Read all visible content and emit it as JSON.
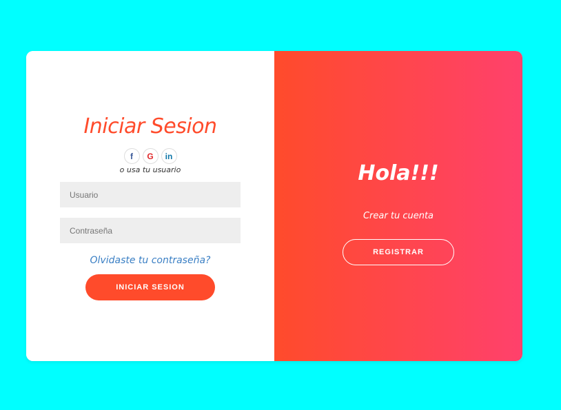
{
  "login": {
    "title": "Iniciar Sesion",
    "social": [
      {
        "name": "facebook-icon",
        "glyph": "f"
      },
      {
        "name": "google-icon",
        "glyph": "G"
      },
      {
        "name": "linkedin-icon",
        "glyph": "in"
      }
    ],
    "alt_text": "o usa tu usuario",
    "username_placeholder": "Usuario",
    "password_placeholder": "Contraseña",
    "forgot_link": "Olvidaste tu contraseña?",
    "submit_label": "INICIAR SESION"
  },
  "overlay": {
    "title": "Hola!!!",
    "subtitle": "Crear tu cuenta",
    "register_label": "REGISTRAR"
  },
  "colors": {
    "page_background": "#00ffff",
    "accent": "#ff4b2b",
    "accent_end": "#ff416c",
    "link": "#3a7fc4",
    "input_background": "#eeeeee"
  }
}
